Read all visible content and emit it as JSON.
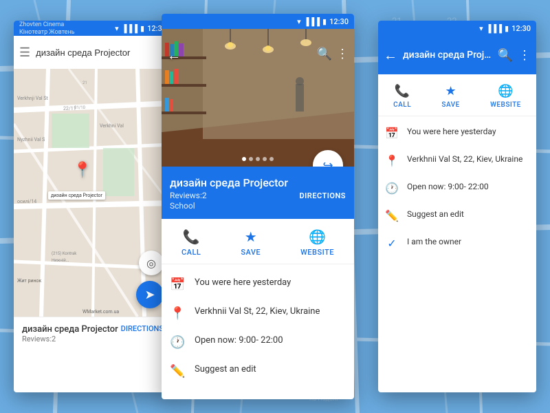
{
  "colors": {
    "primary": "#1a73e8",
    "accent": "#e53935",
    "bg_blue": "#5b9bd5",
    "text_dark": "#333333",
    "text_gray": "#757575",
    "white": "#ffffff"
  },
  "status_bar": {
    "time": "12:30"
  },
  "left_panel": {
    "search_placeholder": "дизайн среда Projector",
    "place_name": "дизайн среда Projector",
    "reviews": "Reviews:2",
    "directions": "DIRECTIONS",
    "map_labels": [
      "Zhovten Cinema",
      "Нижній В",
      "Kontrak",
      "Verkhnji Val St",
      "Жит ринок",
      "WMarket.com.ua"
    ]
  },
  "mid_panel": {
    "place_name": "дизайн среда Projector",
    "reviews": "Reviews:2",
    "directions": "DIRECTIONS",
    "category": "School",
    "actions": [
      {
        "label": "CALL",
        "icon": "📞"
      },
      {
        "label": "SAVE",
        "icon": "★"
      },
      {
        "label": "WEBSITE",
        "icon": "🌐"
      }
    ],
    "info_items": [
      {
        "icon": "📅",
        "text": "You were here yesterday"
      },
      {
        "icon": "📍",
        "text": "Verkhnii Val St, 22, Kiev, Ukraine"
      },
      {
        "icon": "🕐",
        "text": "Open now: 9:00- 22:00"
      },
      {
        "icon": "✏️",
        "text": "Suggest an edit"
      }
    ]
  },
  "right_panel": {
    "title": "дизайн среда Proj…",
    "actions": [
      {
        "label": "CALL",
        "icon": "📞"
      },
      {
        "label": "SAVE",
        "icon": "★"
      },
      {
        "label": "WEBSITE",
        "icon": "🌐"
      }
    ],
    "info_items": [
      {
        "icon": "📅",
        "text": "You were here yesterday"
      },
      {
        "icon": "📍",
        "text": "Verkhnii Val St, 22, Kiev, Ukraine"
      },
      {
        "icon": "🕐",
        "text": "Open now: 9:00- 22:00"
      },
      {
        "icon": "✏️",
        "text": "Suggest an edit"
      },
      {
        "icon": "✓",
        "text": "I am the owner"
      }
    ]
  }
}
